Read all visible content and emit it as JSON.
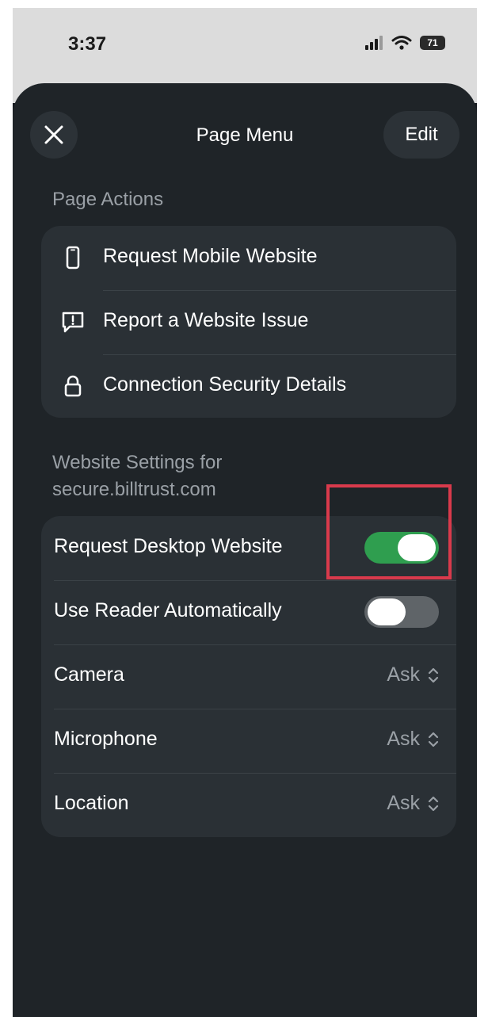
{
  "status_bar": {
    "time": "3:37",
    "battery": "71"
  },
  "header": {
    "title": "Page Menu",
    "edit_label": "Edit"
  },
  "page_actions": {
    "header": "Page Actions",
    "items": [
      {
        "label": "Request Mobile Website",
        "icon": "phone-icon"
      },
      {
        "label": "Report a Website Issue",
        "icon": "report-issue-icon"
      },
      {
        "label": "Connection Security Details",
        "icon": "lock-icon"
      }
    ]
  },
  "website_settings": {
    "header_line1": "Website Settings for",
    "header_line2": "secure.billtrust.com",
    "request_desktop": {
      "label": "Request Desktop Website",
      "enabled": true
    },
    "use_reader": {
      "label": "Use Reader Automatically",
      "enabled": false
    },
    "camera": {
      "label": "Camera",
      "value": "Ask"
    },
    "microphone": {
      "label": "Microphone",
      "value": "Ask"
    },
    "location": {
      "label": "Location",
      "value": "Ask"
    }
  },
  "colors": {
    "toggle_on": "#2f9e4f",
    "highlight": "#d93a4c",
    "sheet_bg": "#1f2428"
  }
}
